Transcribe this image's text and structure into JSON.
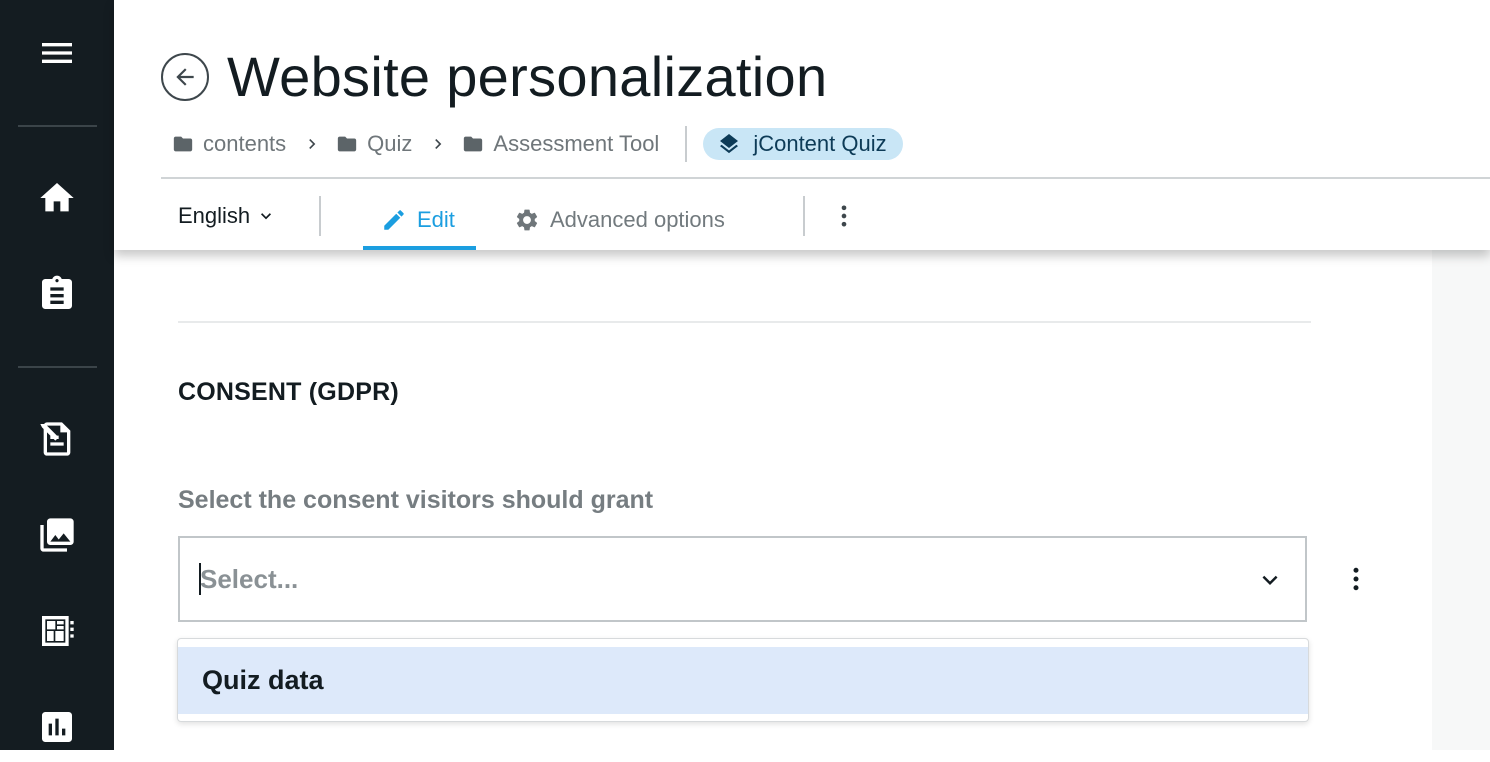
{
  "sidebar": {
    "items": [
      {
        "name": "menu",
        "icon": "hamburger-menu-icon"
      },
      {
        "name": "home",
        "icon": "home-icon"
      },
      {
        "name": "clipboard",
        "icon": "clipboard-icon"
      },
      {
        "name": "content-editor",
        "icon": "edit-document-icon"
      },
      {
        "name": "media",
        "icon": "image-library-icon"
      },
      {
        "name": "page-builder",
        "icon": "page-layout-icon"
      },
      {
        "name": "analytics",
        "icon": "bar-chart-icon"
      }
    ],
    "background": "#141c21"
  },
  "header": {
    "title": "Website personalization",
    "breadcrumb": [
      {
        "label": "contents",
        "icon": "folder-icon"
      },
      {
        "label": "Quiz",
        "icon": "folder-icon"
      },
      {
        "label": "Assessment Tool",
        "icon": "folder-icon"
      }
    ],
    "content_type": {
      "label": "jContent Quiz",
      "icon": "layers-icon"
    },
    "language": "English",
    "tabs": [
      {
        "label": "Edit",
        "icon": "pencil-icon",
        "active": true
      },
      {
        "label": "Advanced options",
        "icon": "gear-icon",
        "active": false
      }
    ]
  },
  "form": {
    "section_title": "CONSENT (GDPR)",
    "field_label": "Select the consent visitors should grant",
    "select_placeholder": "Select...",
    "options": [
      "Quiz data"
    ]
  },
  "colors": {
    "accent": "#1b9ee0",
    "chip_background": "#c9e6f6",
    "option_highlight": "#dde9fa"
  }
}
